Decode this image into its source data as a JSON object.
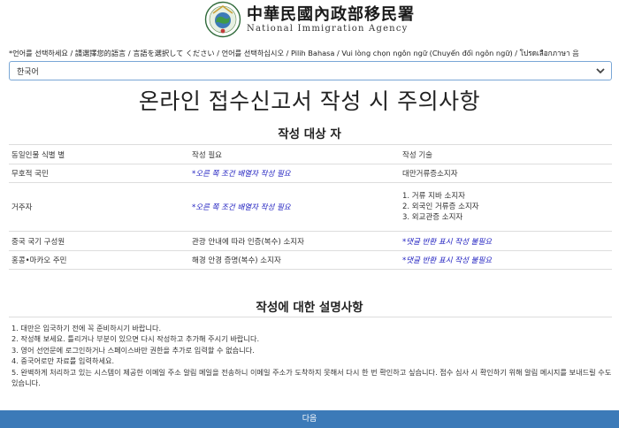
{
  "header": {
    "org_name_cn": "中華民國內政部移民署",
    "org_name_en": "National Immigration Agency"
  },
  "language": {
    "prompt": "*언어를 선택하세요 / 請選擇您的語言 / 言語を選択して ください / 언어를 선택하십시오 / Pilih Bahasa / Vui lòng chọn ngôn ngữ (Chuyển đổi ngôn ngữ) / โปรดเลือกภาษา 음",
    "selected": "한국어",
    "icon": "chevron-down-icon"
  },
  "page_title": "온라인 접수신고서 작성 시 주의사항",
  "section1": {
    "title": "작성 대상 자",
    "headers": [
      "동일인물 식별 별",
      "작성 필요",
      "작성 기술"
    ],
    "rows": [
      {
        "c1": "무호적 국민",
        "c2": "*오른 쪽 조건 배열자 작성 필요",
        "c3": [
          "대만거류증소지자"
        ]
      },
      {
        "c1": "거주자",
        "c2": "*오른 쪽 조건 배열자 작성 필요",
        "c3": [
          "1. 거류 지바 소지자",
          "2. 외국인 거류증 소지자",
          "3. 외교관증 소지자"
        ]
      },
      {
        "c1": "중국 국기 구성원",
        "c2": "관광 안내에 따라 인증(복수) 소지자",
        "c3": [
          "*댓글 반환 표시 작성 불필요"
        ]
      },
      {
        "c1": "홍콩•마카오 주민",
        "c2": "해경 안경 증명(복수) 소지자",
        "c3": [
          "*댓글 반환 표시 작성 불필요"
        ]
      }
    ]
  },
  "section2": {
    "title": "작성에 대한 설명사항",
    "items": [
      "1. 대만은 입국하기 전에 꼭 준비하시기 바랍니다.",
      "2. 작성해 보세요. 틀리거나 부분이 있으면 다시 작성하고 추가해 주시기 바랍니다.",
      "3. 영어 선언문에 로그인하거나 스페이스바만 권한을 추가로 입력할 수 없습니다.",
      "4. 중국어로만 자료를 입력하세요.",
      "5. 완벽하게 처리하고 있는 시스템이 제공한 이메일 주소 알림 메일을 전송하니 이메일 주소가 도착하지 못해서 다시 한 번 확인하고 싶습니다. 접수 심사 시 확인하기 위해 알림 메시지를 보내드릴 수도 있습니다."
    ]
  },
  "next_button": "다음",
  "colors": {
    "accent": "#3c7ab8",
    "emphasis": "#2020c0"
  }
}
